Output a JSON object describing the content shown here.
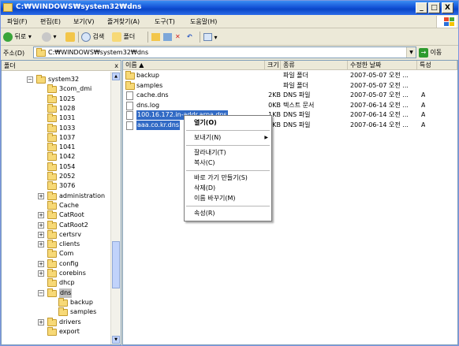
{
  "window": {
    "title": "C:\\WINDOWS\\system32\\dns",
    "title_display": "C:₩WINDOWS₩system32₩dns",
    "buttons": {
      "minimize": "_",
      "maximize": "□",
      "close": "X"
    }
  },
  "menu": [
    {
      "label": "파일(F)"
    },
    {
      "label": "편집(E)"
    },
    {
      "label": "보기(V)"
    },
    {
      "label": "즐겨찾기(A)"
    },
    {
      "label": "도구(T)"
    },
    {
      "label": "도움말(H)"
    }
  ],
  "toolbar": {
    "back_label": "뒤로",
    "search_label": "검색",
    "folders_label": "폴더"
  },
  "address": {
    "label": "주소(D)",
    "value": "C:₩WINDOWS₩system32₩dns",
    "go_label": "이동"
  },
  "folder_pane": {
    "header": "폴더",
    "close": "x",
    "items": [
      {
        "label": "system32",
        "expander": "−"
      },
      {
        "label": "3com_dmi",
        "expander": ""
      },
      {
        "label": "1025",
        "expander": ""
      },
      {
        "label": "1028",
        "expander": ""
      },
      {
        "label": "1031",
        "expander": ""
      },
      {
        "label": "1033",
        "expander": ""
      },
      {
        "label": "1037",
        "expander": ""
      },
      {
        "label": "1041",
        "expander": ""
      },
      {
        "label": "1042",
        "expander": ""
      },
      {
        "label": "1054",
        "expander": ""
      },
      {
        "label": "2052",
        "expander": ""
      },
      {
        "label": "3076",
        "expander": ""
      },
      {
        "label": "administration",
        "expander": "+"
      },
      {
        "label": "Cache",
        "expander": ""
      },
      {
        "label": "CatRoot",
        "expander": "+"
      },
      {
        "label": "CatRoot2",
        "expander": "+"
      },
      {
        "label": "certsrv",
        "expander": "+"
      },
      {
        "label": "clients",
        "expander": "+"
      },
      {
        "label": "Com",
        "expander": ""
      },
      {
        "label": "config",
        "expander": "+"
      },
      {
        "label": "corebins",
        "expander": "+"
      },
      {
        "label": "dhcp",
        "expander": ""
      },
      {
        "label": "dns",
        "expander": "−"
      },
      {
        "label": "backup",
        "expander": ""
      },
      {
        "label": "samples",
        "expander": ""
      },
      {
        "label": "drivers",
        "expander": "+"
      },
      {
        "label": "export",
        "expander": ""
      }
    ]
  },
  "list": {
    "columns": [
      "이름 ▲",
      "크기",
      "종류",
      "수정한 날짜",
      "특성"
    ],
    "rows": [
      {
        "name": "backup",
        "size": "",
        "type": "파일 폴더",
        "date": "2007-05-07 오전 ...",
        "attr": "",
        "icon": "folder-icon"
      },
      {
        "name": "samples",
        "size": "",
        "type": "파일 폴더",
        "date": "2007-05-07 오전 ...",
        "attr": "",
        "icon": "folder-icon"
      },
      {
        "name": "cache.dns",
        "size": "2KB",
        "type": "DNS 파일",
        "date": "2007-05-07 오전 ...",
        "attr": "A",
        "icon": "file-icon"
      },
      {
        "name": "dns.log",
        "size": "0KB",
        "type": "텍스트 문서",
        "date": "2007-06-14 오전 ...",
        "attr": "A",
        "icon": "file-icon"
      },
      {
        "name": "100.16.172.in-addr.arpa.dns",
        "size": "1KB",
        "type": "DNS 파일",
        "date": "2007-06-14 오전 ...",
        "attr": "A",
        "icon": "file-icon",
        "selected": true
      },
      {
        "name": "aaa.co.kr.dns",
        "size": "1KB",
        "type": "DNS 파일",
        "date": "2007-06-14 오전 ...",
        "attr": "A",
        "icon": "file-icon",
        "selected": true
      }
    ]
  },
  "context_menu": {
    "open": "열기(O)",
    "send_to": "보내기(N)",
    "cut": "잘라내기(T)",
    "copy": "복사(C)",
    "shortcut": "바로 가기 만들기(S)",
    "delete": "삭제(D)",
    "rename": "이름 바꾸기(M)",
    "properties": "속성(R)"
  },
  "colors": {
    "title_bar": "#0a46c7",
    "selection": "#316ac5",
    "folder": "#f7d977"
  }
}
